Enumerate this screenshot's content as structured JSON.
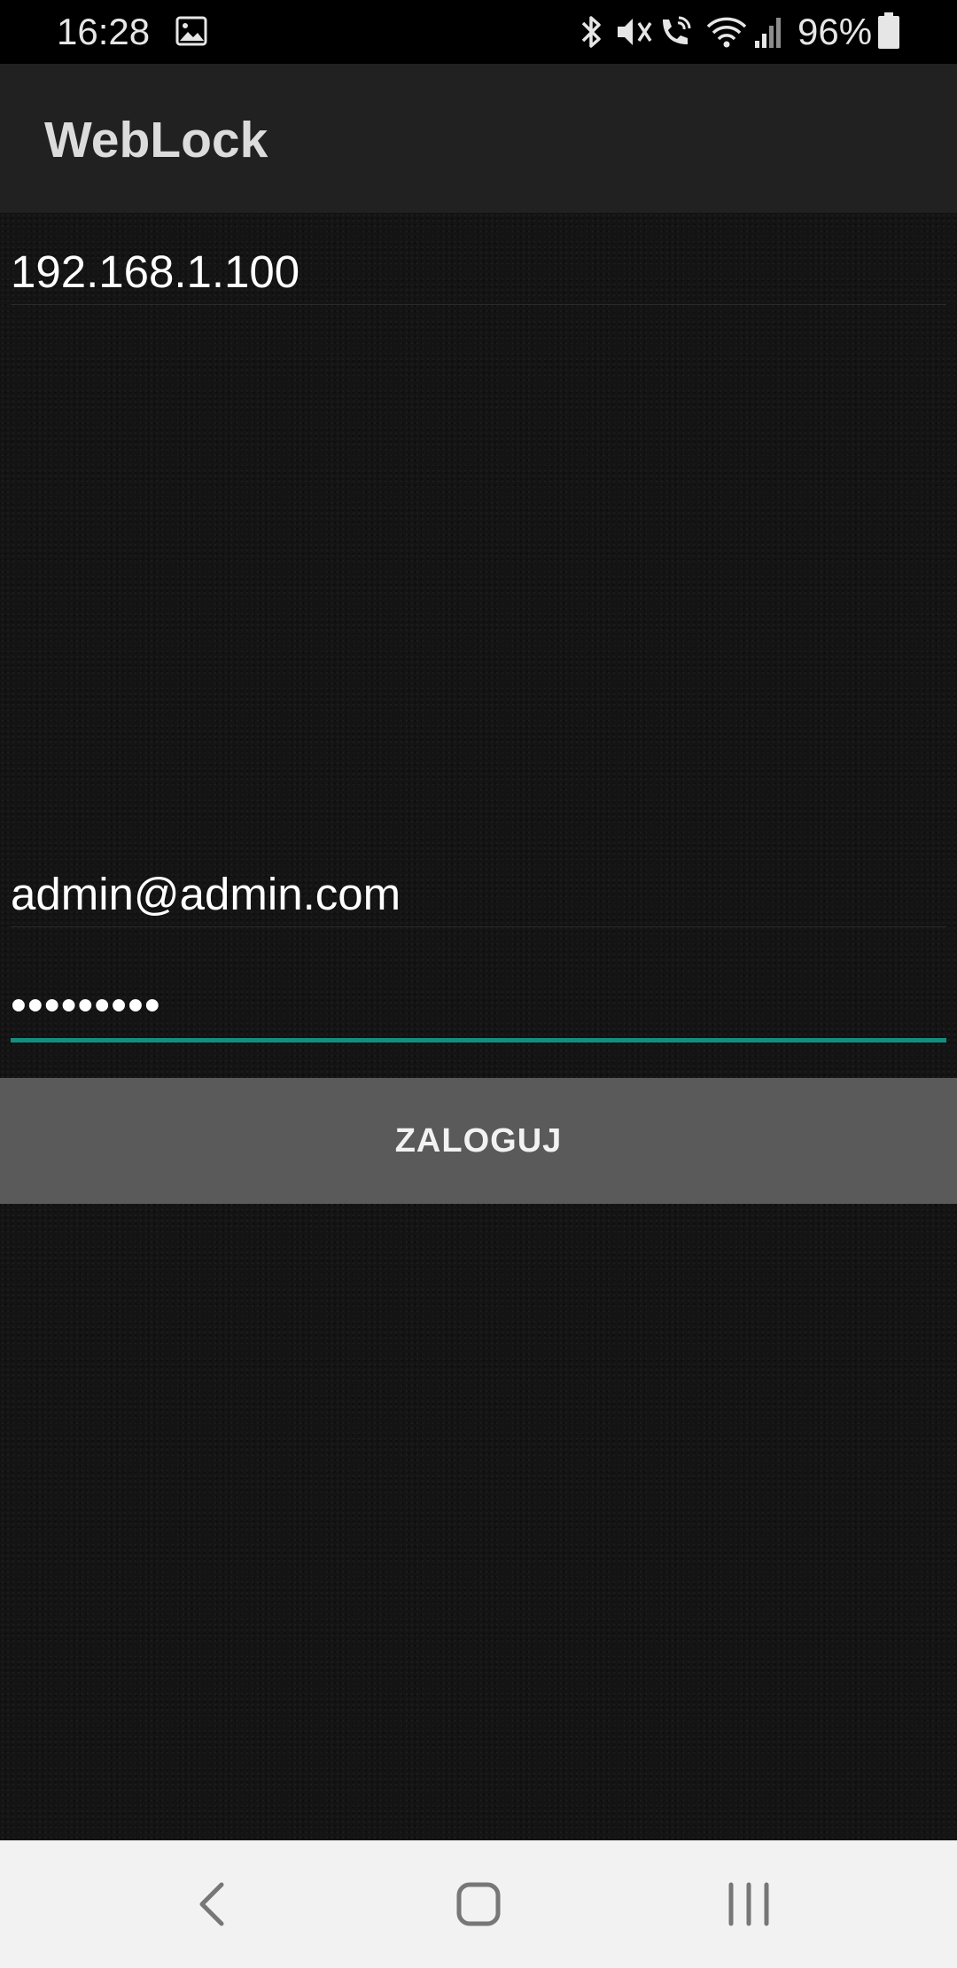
{
  "status_bar": {
    "time": "16:28",
    "battery_percent": "96%",
    "icons": [
      "gallery-icon",
      "bluetooth-icon",
      "mute-icon",
      "wifi-calling-icon",
      "wifi-icon",
      "signal-icon",
      "battery-icon"
    ]
  },
  "app_bar": {
    "title": "WebLock"
  },
  "login_form": {
    "host_value": "192.168.1.100",
    "email_value": "admin@admin.com",
    "password_mask": "•••••••••",
    "login_label": "ZALOGUJ"
  },
  "colors": {
    "app_bar": "#212121",
    "background": "#141414",
    "accent_underline": "#138f80",
    "button": "#5a5a5a",
    "nav_bar": "#f2f2f2"
  },
  "nav_bar": {
    "icons": [
      "back-icon",
      "home-icon",
      "recents-icon"
    ]
  }
}
